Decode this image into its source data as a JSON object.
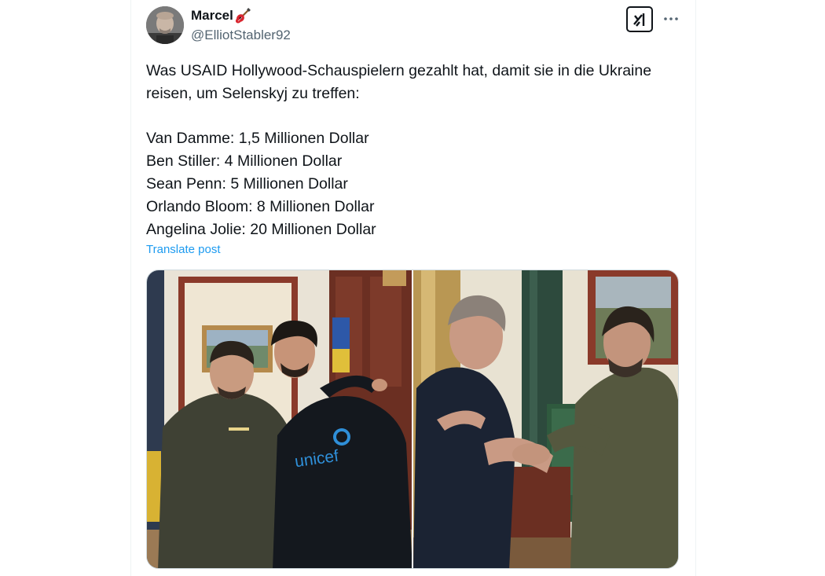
{
  "author": {
    "display_name": "Marcel",
    "handle": "@ElliotStabler92"
  },
  "icons": {
    "avatar": "avatar-photo",
    "name_emoji": "guitar-icon",
    "grok": "grok-icon",
    "more": "more-icon"
  },
  "tweet": {
    "intro": "Was USAID Hollywood-Schauspielern gezahlt hat, damit sie in die Ukraine reisen, um Selenskyj zu treffen:",
    "lines": [
      "Van Damme: 1,5 Millionen Dollar",
      "Ben Stiller: 4 Millionen Dollar",
      "Sean Penn: 5 Millionen Dollar",
      "Orlando Bloom: 8 Millionen Dollar",
      "Angelina Jolie: 20 Millionen Dollar"
    ],
    "translate_label": "Translate post"
  },
  "media": {
    "left_hoodie_text": "unicef",
    "colors": {
      "link": "#1d9bf0",
      "text": "#0f1419",
      "secondary": "#536471"
    }
  }
}
